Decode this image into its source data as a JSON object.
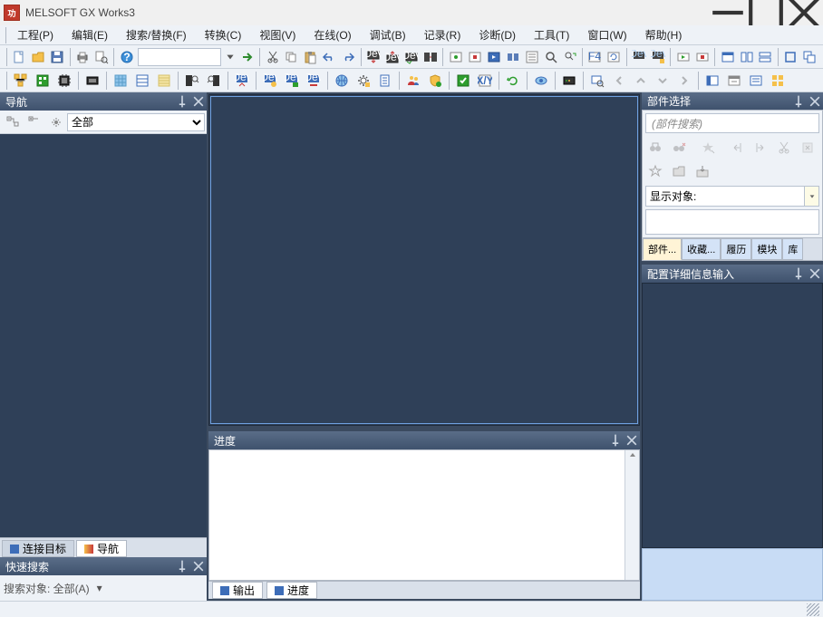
{
  "title": "MELSOFT GX Works3",
  "menus": [
    "工程(P)",
    "编辑(E)",
    "搜索/替换(F)",
    "转换(C)",
    "视图(V)",
    "在线(O)",
    "调试(B)",
    "记录(R)",
    "诊断(D)",
    "工具(T)",
    "窗口(W)",
    "帮助(H)"
  ],
  "nav": {
    "title": "导航",
    "filter_default": "全部",
    "tab_connect": "连接目标",
    "tab_nav": "导航"
  },
  "quicksearch": {
    "title": "快速搜索",
    "label": "搜索对象: 全部(A)"
  },
  "progress": {
    "title": "进度"
  },
  "bottom_tabs": {
    "output": "输出",
    "progress": "进度"
  },
  "parts": {
    "title": "部件选择",
    "search_placeholder": "(部件搜索)",
    "display_label": "显示对象:",
    "tabs": [
      "部件...",
      "收藏...",
      "履历",
      "模块",
      "库"
    ]
  },
  "config": {
    "title": "配置详细信息输入"
  }
}
